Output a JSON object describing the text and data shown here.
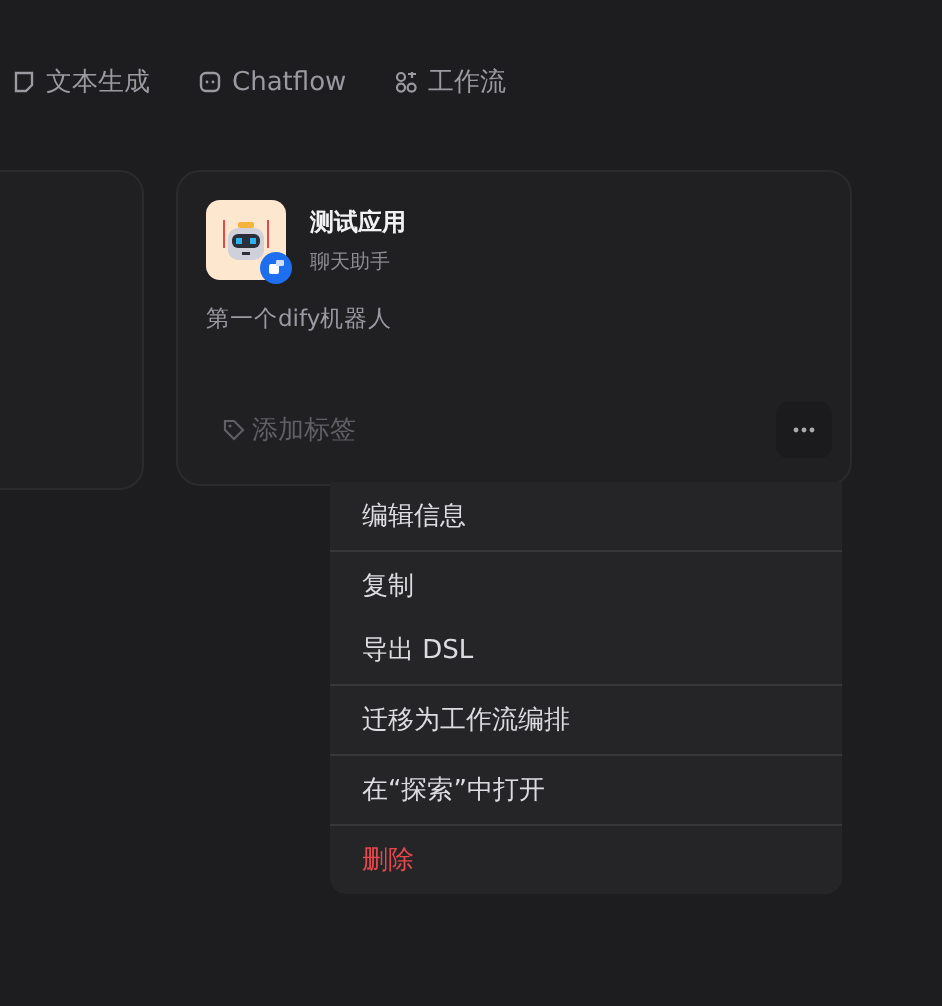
{
  "tabs": [
    {
      "label": "文本生成",
      "kind": "document"
    },
    {
      "label": "Chatflow",
      "kind": "chat"
    },
    {
      "label": "工作流",
      "kind": "workflow"
    }
  ],
  "app_card": {
    "title": "测试应用",
    "subtitle": "聊天助手",
    "description": "第一个dify机器人",
    "tag_button": "添加标签"
  },
  "context_menu": {
    "groups": [
      [
        {
          "label": "编辑信息",
          "kind": "normal"
        }
      ],
      [
        {
          "label": "复制",
          "kind": "normal"
        },
        {
          "label": "导出 DSL",
          "kind": "normal"
        }
      ],
      [
        {
          "label": "迁移为工作流编排",
          "kind": "normal"
        }
      ],
      [
        {
          "label": "在“探索”中打开",
          "kind": "normal"
        }
      ],
      [
        {
          "label": "删除",
          "kind": "danger"
        }
      ]
    ]
  }
}
